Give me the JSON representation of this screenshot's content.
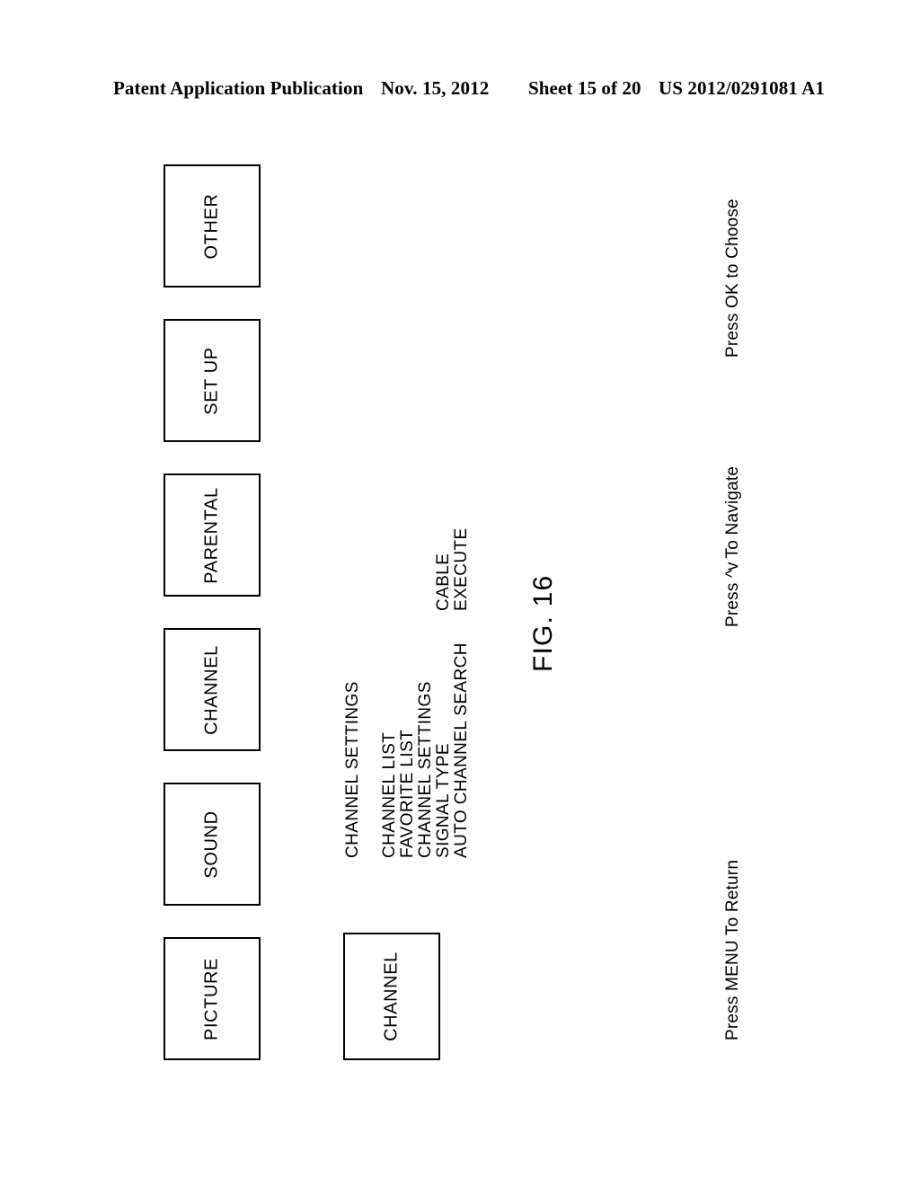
{
  "header": {
    "publication": "Patent Application Publication",
    "date": "Nov. 15, 2012",
    "sheet": "Sheet 15 of 20",
    "patent_number": "US 2012/0291081 A1"
  },
  "figure": {
    "caption": "FIG. 16",
    "menu_bar": {
      "items": [
        {
          "label": "PICTURE"
        },
        {
          "label": "SOUND"
        },
        {
          "label": "CHANNEL"
        },
        {
          "label": "PARENTAL"
        },
        {
          "label": "SET UP"
        },
        {
          "label": "OTHER"
        }
      ]
    },
    "selected_category": {
      "label": "CHANNEL"
    },
    "submenu": {
      "title": "CHANNEL SETTINGS",
      "rows": [
        {
          "label": "CHANNEL LIST",
          "value": ""
        },
        {
          "label": "FAVORITE LIST",
          "value": ""
        },
        {
          "label": "CHANNEL SETTINGS",
          "value": ""
        },
        {
          "label": "SIGNAL TYPE",
          "value": "CABLE"
        },
        {
          "label": "AUTO CHANNEL SEARCH",
          "value": "EXECUTE"
        }
      ]
    },
    "hints": [
      {
        "text": "Press MENU To Return"
      },
      {
        "prefix": "Press ",
        "glyphs": "^v",
        "suffix": " To Navigate"
      },
      {
        "text": "Press OK to Choose"
      }
    ]
  },
  "colors": {
    "ink": "#000000",
    "paper": "#ffffff"
  }
}
